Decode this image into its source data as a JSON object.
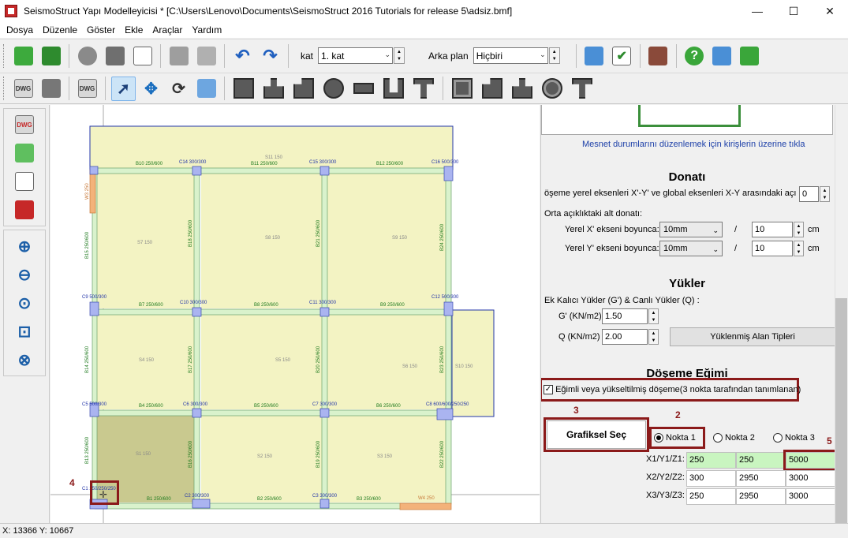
{
  "window": {
    "title": "SeismoStruct Yapı Modelleyicisi * [C:\\Users\\Lenovo\\Documents\\SeismoStruct 2016 Tutorials for release 5\\adsiz.bmf]",
    "minimize": "—",
    "maximize": "☐",
    "close": "✕"
  },
  "menu": [
    "Dosya",
    "Düzenle",
    "Göster",
    "Ekle",
    "Araçlar",
    "Yardım"
  ],
  "toolbar": {
    "kat_label": "kat",
    "kat_value": "1. kat",
    "arka_plan_label": "Arka plan",
    "arka_plan_value": "Hiçbiri",
    "dwg_label": "DWG"
  },
  "plan": {
    "slabs": [
      {
        "name": "S11 150"
      },
      {
        "name": "S7 150"
      },
      {
        "name": "S8 150"
      },
      {
        "name": "S9 150"
      },
      {
        "name": "S4 150"
      },
      {
        "name": "S5 150"
      },
      {
        "name": "S6 150"
      },
      {
        "name": "S10 150"
      },
      {
        "name": "S1 150"
      },
      {
        "name": "S2 150"
      },
      {
        "name": "S3 150"
      }
    ],
    "beams": [
      "B10 250/600",
      "C14 300/300",
      "B11 250/600",
      "C15 300/300",
      "B12 250/600",
      "C16 500/300",
      "B7 250/600",
      "C10 300/300",
      "B8 250/600",
      "C11 300/300",
      "B9 250/600",
      "C12 500/300",
      "C9 500/300",
      "B4 250/600",
      "C6 300/300",
      "B5 250/600",
      "C7 300/300",
      "B6 250/600",
      "C8 600/600/250/250",
      "C5 500/300",
      "B1 250/600",
      "C2 300/300",
      "B2 250/600",
      "C3 300/300",
      "B3 250/600",
      "W4 250",
      "C1 250/250/250"
    ],
    "vertical_beams": [
      "B15 250/600",
      "B18 250/600",
      "B21 250/600",
      "B24 250/600",
      "W3 250",
      "B14 250/600",
      "B17 250/600",
      "B20 250/600",
      "B23 250/600",
      "B13 250/600",
      "B16 250/600",
      "B19 250/600",
      "B22 250/600"
    ]
  },
  "panel": {
    "support_link": "Mesnet durumlarını düzenlemek için kirişlerin üzerine tıkla",
    "donati_heading": "Donatı",
    "angle_label": "öşeme yerel eksenleri X'-Y' ve global eksenleri X-Y arasındaki açı (°)",
    "angle_value": "0",
    "alt_donati_label": "Orta açıklıktaki alt donatı:",
    "x_label": "Yerel X' ekseni boyunca:",
    "x_combo": "10mm",
    "x_value": "10",
    "y_label": "Yerel Y' ekseni boyunca:",
    "y_combo": "10mm",
    "y_value": "10",
    "slash": "/",
    "cm": "cm",
    "yukler_heading": "Yükler",
    "yukler_label": "Ek Kalıcı Yükler (G') & Canlı Yükler (Q) :",
    "g_label": "G' (KN/m2)",
    "g_value": "1.50",
    "q_label": "Q (KN/m2)",
    "q_value": "2.00",
    "alan_button": "Yüklenmiş Alan Tipleri",
    "egim_heading": "Döşeme Eğimi",
    "egim_checkbox": "Eğimli veya yükseltilmiş döşeme(3 nokta tarafından tanımlanan)",
    "grafiksel_button": "Grafiksel Seç",
    "nokta1": "Nokta 1",
    "nokta2": "Nokta 2",
    "nokta3": "Nokta 3",
    "rows": [
      {
        "label": "X1/Y1/Z1:",
        "values": [
          "250",
          "250",
          "5000"
        ]
      },
      {
        "label": "X2/Y2/Z2:",
        "values": [
          "300",
          "2950",
          "3000"
        ]
      },
      {
        "label": "X3/Y3/Z3:",
        "values": [
          "250",
          "2950",
          "3000"
        ]
      }
    ]
  },
  "callouts": {
    "c1": "1",
    "c2": "2",
    "c3": "3",
    "c4": "4",
    "c5": "5"
  },
  "status": "X: 13366  Y: 10667"
}
